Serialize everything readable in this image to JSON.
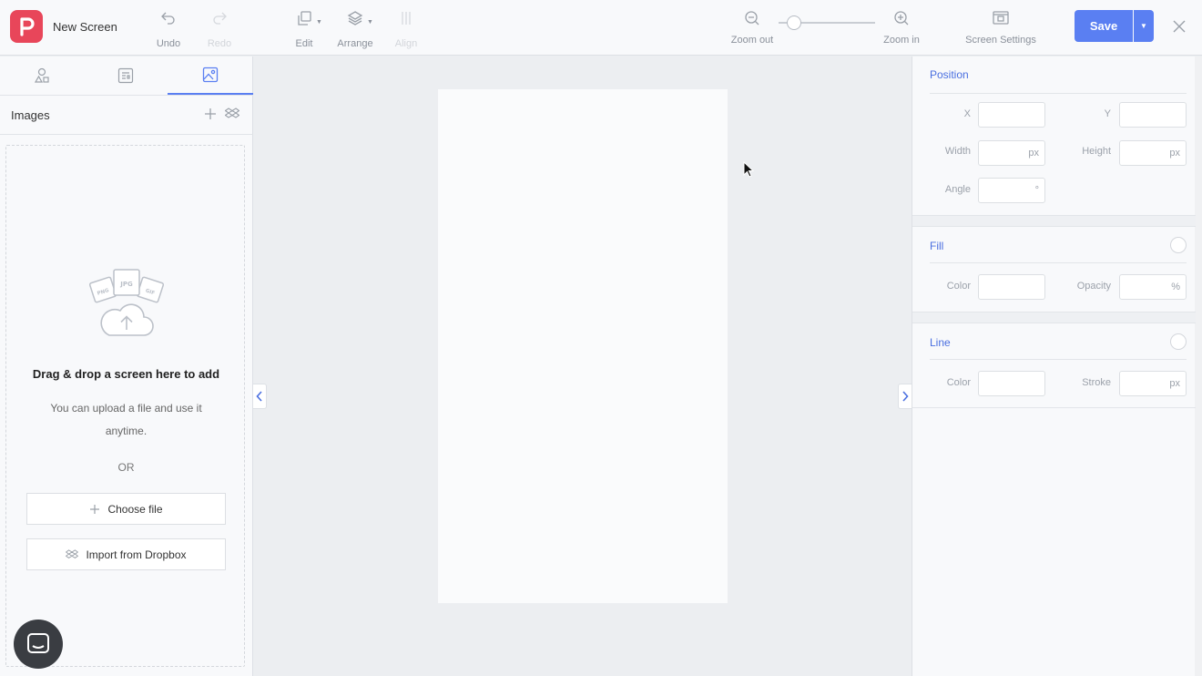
{
  "app": {
    "title": "New Screen",
    "accent_color": "#5a7ff2",
    "brand_color": "#e8465a"
  },
  "toolbar": {
    "undo": "Undo",
    "redo": "Redo",
    "edit": "Edit",
    "arrange": "Arrange",
    "align": "Align",
    "zoom_out": "Zoom out",
    "zoom_in": "Zoom in",
    "screen_settings": "Screen Settings",
    "save": "Save"
  },
  "left_panel": {
    "tabs": [
      {
        "icon": "shapes-icon"
      },
      {
        "icon": "components-icon"
      },
      {
        "icon": "image-icon",
        "active": true
      }
    ],
    "section_title": "Images",
    "dropzone": {
      "illustration_labels": [
        "PNG",
        "JPG",
        "GIF"
      ],
      "heading": "Drag & drop a screen here to add",
      "description": "You can upload a file and use it anytime.",
      "or": "OR",
      "choose_file": "Choose file",
      "import_dropbox": "Import from Dropbox"
    }
  },
  "right_panel": {
    "position": {
      "title": "Position",
      "x_label": "X",
      "y_label": "Y",
      "width_label": "Width",
      "height_label": "Height",
      "angle_label": "Angle",
      "unit_px": "px",
      "unit_deg": "°"
    },
    "fill": {
      "title": "Fill",
      "color_label": "Color",
      "opacity_label": "Opacity",
      "unit_percent": "%"
    },
    "line": {
      "title": "Line",
      "color_label": "Color",
      "stroke_label": "Stroke",
      "unit_px": "px"
    }
  }
}
